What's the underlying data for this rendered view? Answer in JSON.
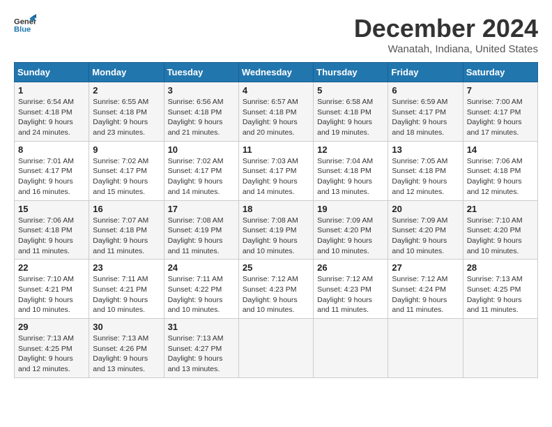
{
  "header": {
    "logo_text_general": "General",
    "logo_text_blue": "Blue",
    "month_title": "December 2024",
    "location": "Wanatah, Indiana, United States"
  },
  "calendar": {
    "days_of_week": [
      "Sunday",
      "Monday",
      "Tuesday",
      "Wednesday",
      "Thursday",
      "Friday",
      "Saturday"
    ],
    "weeks": [
      [
        {
          "day": "1",
          "sunrise": "6:54 AM",
          "sunset": "4:18 PM",
          "daylight": "9 hours and 24 minutes."
        },
        {
          "day": "2",
          "sunrise": "6:55 AM",
          "sunset": "4:18 PM",
          "daylight": "9 hours and 23 minutes."
        },
        {
          "day": "3",
          "sunrise": "6:56 AM",
          "sunset": "4:18 PM",
          "daylight": "9 hours and 21 minutes."
        },
        {
          "day": "4",
          "sunrise": "6:57 AM",
          "sunset": "4:18 PM",
          "daylight": "9 hours and 20 minutes."
        },
        {
          "day": "5",
          "sunrise": "6:58 AM",
          "sunset": "4:18 PM",
          "daylight": "9 hours and 19 minutes."
        },
        {
          "day": "6",
          "sunrise": "6:59 AM",
          "sunset": "4:17 PM",
          "daylight": "9 hours and 18 minutes."
        },
        {
          "day": "7",
          "sunrise": "7:00 AM",
          "sunset": "4:17 PM",
          "daylight": "9 hours and 17 minutes."
        }
      ],
      [
        {
          "day": "8",
          "sunrise": "7:01 AM",
          "sunset": "4:17 PM",
          "daylight": "9 hours and 16 minutes."
        },
        {
          "day": "9",
          "sunrise": "7:02 AM",
          "sunset": "4:17 PM",
          "daylight": "9 hours and 15 minutes."
        },
        {
          "day": "10",
          "sunrise": "7:02 AM",
          "sunset": "4:17 PM",
          "daylight": "9 hours and 14 minutes."
        },
        {
          "day": "11",
          "sunrise": "7:03 AM",
          "sunset": "4:17 PM",
          "daylight": "9 hours and 14 minutes."
        },
        {
          "day": "12",
          "sunrise": "7:04 AM",
          "sunset": "4:18 PM",
          "daylight": "9 hours and 13 minutes."
        },
        {
          "day": "13",
          "sunrise": "7:05 AM",
          "sunset": "4:18 PM",
          "daylight": "9 hours and 12 minutes."
        },
        {
          "day": "14",
          "sunrise": "7:06 AM",
          "sunset": "4:18 PM",
          "daylight": "9 hours and 12 minutes."
        }
      ],
      [
        {
          "day": "15",
          "sunrise": "7:06 AM",
          "sunset": "4:18 PM",
          "daylight": "9 hours and 11 minutes."
        },
        {
          "day": "16",
          "sunrise": "7:07 AM",
          "sunset": "4:18 PM",
          "daylight": "9 hours and 11 minutes."
        },
        {
          "day": "17",
          "sunrise": "7:08 AM",
          "sunset": "4:19 PM",
          "daylight": "9 hours and 11 minutes."
        },
        {
          "day": "18",
          "sunrise": "7:08 AM",
          "sunset": "4:19 PM",
          "daylight": "9 hours and 10 minutes."
        },
        {
          "day": "19",
          "sunrise": "7:09 AM",
          "sunset": "4:20 PM",
          "daylight": "9 hours and 10 minutes."
        },
        {
          "day": "20",
          "sunrise": "7:09 AM",
          "sunset": "4:20 PM",
          "daylight": "9 hours and 10 minutes."
        },
        {
          "day": "21",
          "sunrise": "7:10 AM",
          "sunset": "4:20 PM",
          "daylight": "9 hours and 10 minutes."
        }
      ],
      [
        {
          "day": "22",
          "sunrise": "7:10 AM",
          "sunset": "4:21 PM",
          "daylight": "9 hours and 10 minutes."
        },
        {
          "day": "23",
          "sunrise": "7:11 AM",
          "sunset": "4:21 PM",
          "daylight": "9 hours and 10 minutes."
        },
        {
          "day": "24",
          "sunrise": "7:11 AM",
          "sunset": "4:22 PM",
          "daylight": "9 hours and 10 minutes."
        },
        {
          "day": "25",
          "sunrise": "7:12 AM",
          "sunset": "4:23 PM",
          "daylight": "9 hours and 10 minutes."
        },
        {
          "day": "26",
          "sunrise": "7:12 AM",
          "sunset": "4:23 PM",
          "daylight": "9 hours and 11 minutes."
        },
        {
          "day": "27",
          "sunrise": "7:12 AM",
          "sunset": "4:24 PM",
          "daylight": "9 hours and 11 minutes."
        },
        {
          "day": "28",
          "sunrise": "7:13 AM",
          "sunset": "4:25 PM",
          "daylight": "9 hours and 11 minutes."
        }
      ],
      [
        {
          "day": "29",
          "sunrise": "7:13 AM",
          "sunset": "4:25 PM",
          "daylight": "9 hours and 12 minutes."
        },
        {
          "day": "30",
          "sunrise": "7:13 AM",
          "sunset": "4:26 PM",
          "daylight": "9 hours and 13 minutes."
        },
        {
          "day": "31",
          "sunrise": "7:13 AM",
          "sunset": "4:27 PM",
          "daylight": "9 hours and 13 minutes."
        },
        null,
        null,
        null,
        null
      ]
    ]
  }
}
